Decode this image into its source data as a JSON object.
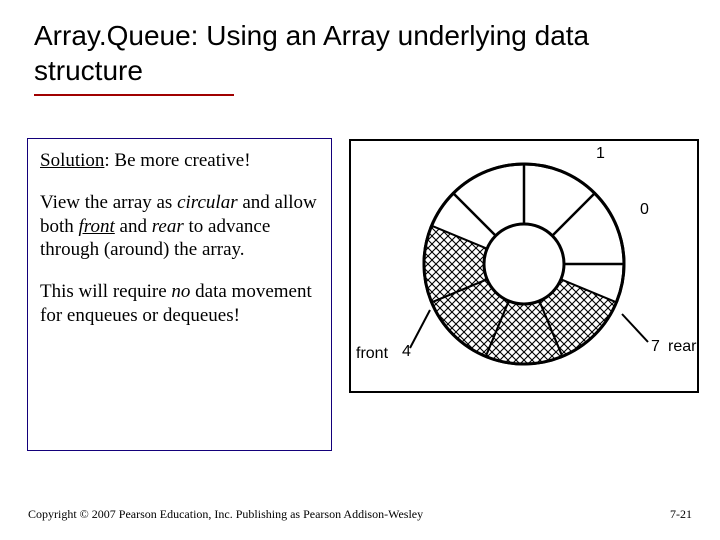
{
  "title": "Array.Queue: Using an Array underlying data structure",
  "solution_label": "Solution",
  "solution_text": ": Be more creative!",
  "para1_pre": "View the array as ",
  "para1_circular": "circular",
  "para1_mid1": " and allow both ",
  "para1_front": "front",
  "para1_mid2": " and ",
  "para1_rear": "rear",
  "para1_post": " to advance through (around) the array.",
  "para2_pre": "This will require ",
  "para2_no": "no",
  "para2_post": " data movement for enqueues or dequeues!",
  "footer": "Copyright © 2007 Pearson Education, Inc. Publishing as Pearson Addison-Wesley",
  "page_num": "7-21",
  "diagram": {
    "labels": {
      "n0": "0",
      "n1": "1",
      "n7": "7",
      "n4": "4",
      "front": "front",
      "rear": "rear"
    }
  }
}
